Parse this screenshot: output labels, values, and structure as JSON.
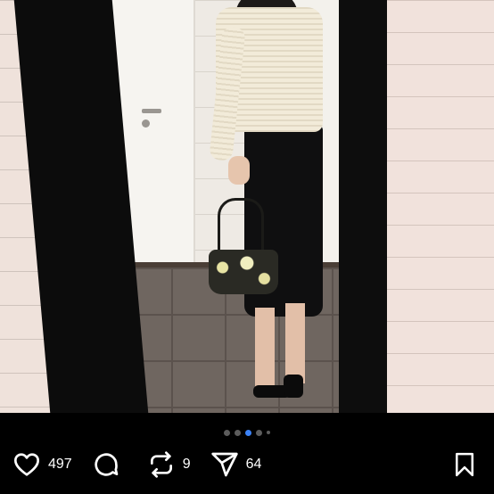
{
  "post": {
    "carousel": {
      "total": 5,
      "active_index": 2
    },
    "actions": {
      "like_count": "497",
      "comment_count": "",
      "repost_count": "9",
      "share_count": "64"
    },
    "icons": {
      "like": "heart-icon",
      "comment": "comment-bubble-icon",
      "repost": "repost-icon",
      "share": "send-icon",
      "save": "bookmark-icon"
    }
  },
  "colors": {
    "background": "#000000",
    "icon": "#ffffff",
    "pager_active": "#3b82f6",
    "pager_inactive": "#5c5c5c"
  }
}
